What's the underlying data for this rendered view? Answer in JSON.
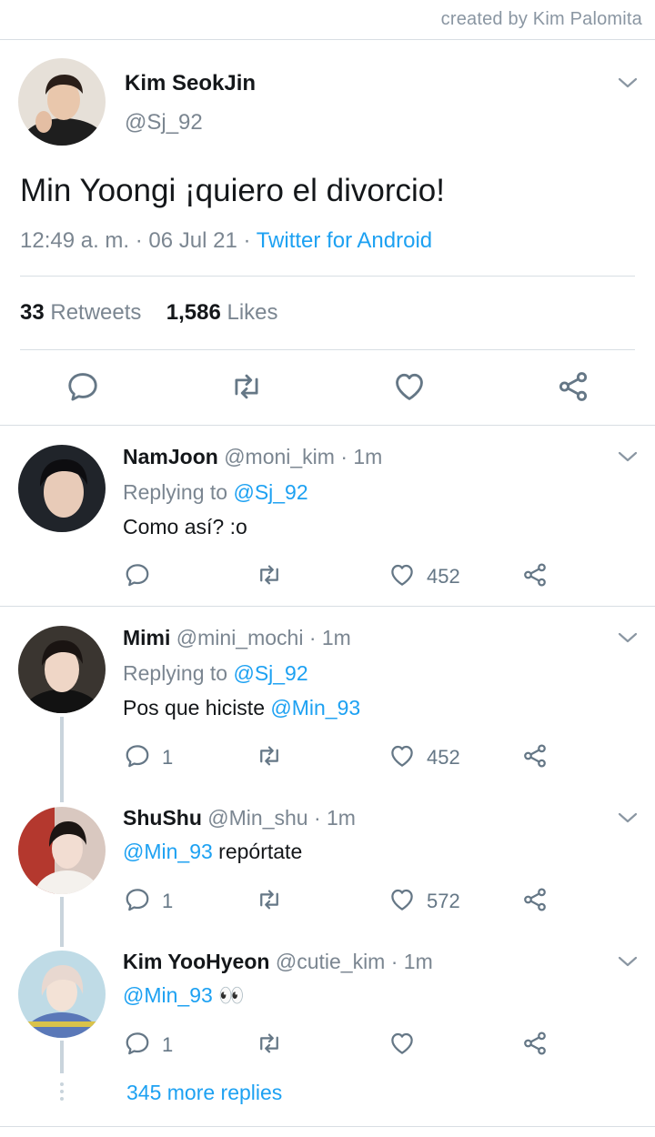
{
  "credit": "created by Kim Palomita",
  "main_tweet": {
    "author_name": "Kim SeokJin",
    "author_handle": "@Sj_92",
    "text": "Min Yoongi ¡quiero el divorcio!",
    "time": "12:49 a. m. · 06 Jul 21 · ",
    "source": "Twitter for Android",
    "retweets_count": "33",
    "retweets_label": "Retweets",
    "likes_count": "1,586",
    "likes_label": "Likes"
  },
  "replies": [
    {
      "name": "NamJoon",
      "meta": "@moni_kim · 1m",
      "replying_prefix": "Replying to ",
      "replying_handle": "@Sj_92",
      "text": "Como así? :o",
      "reply_count": "",
      "like_count": "452"
    },
    {
      "name": "Mimi",
      "meta": "@mini_mochi · 1m",
      "replying_prefix": "Replying to ",
      "replying_handle": "@Sj_92",
      "text_prefix": "Pos que hiciste ",
      "text_mention": "@Min_93",
      "reply_count": "1",
      "like_count": "452"
    },
    {
      "name": "ShuShu",
      "meta": "@Min_shu · 1m",
      "text_mention": "@Min_93",
      "text": " repórtate",
      "reply_count": "1",
      "like_count": "572"
    },
    {
      "name": "Kim YooHyeon",
      "meta": "@cutie_kim · 1m",
      "text_mention": "@Min_93",
      "text": " 👀",
      "reply_count": "1",
      "like_count": ""
    }
  ],
  "more_replies": "345 more replies",
  "colors": {
    "accent": "#1da1f2",
    "muted": "#657786",
    "divider": "#d8dee3"
  }
}
